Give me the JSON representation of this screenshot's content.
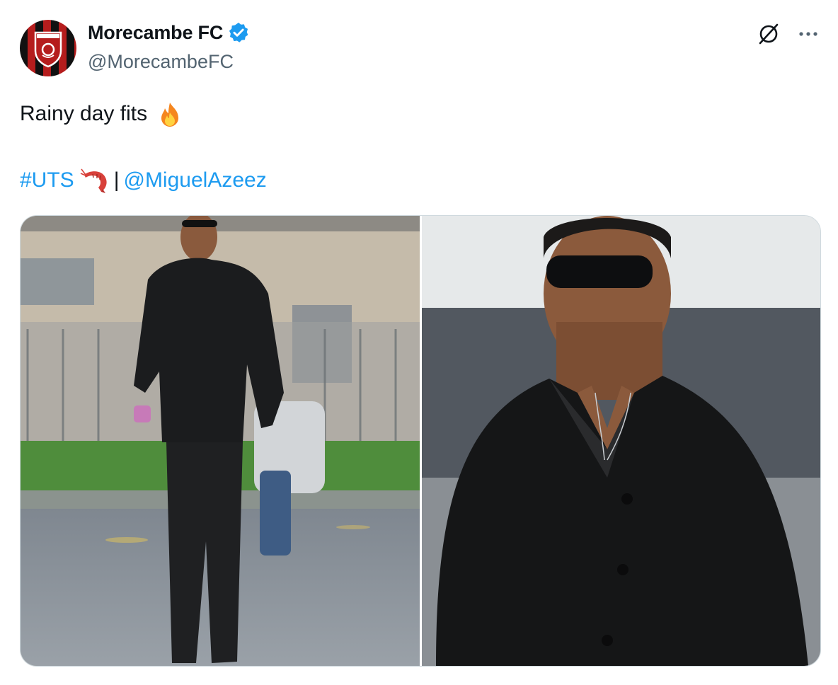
{
  "account": {
    "display_name": "Morecambe FC",
    "handle": "@MorecambeFC",
    "verified": true,
    "avatar": "morecambe-fc-crest"
  },
  "header_icons": {
    "grok": "grok-icon",
    "more": "more-options-icon"
  },
  "tweet": {
    "text": "Rainy day fits",
    "text_emoji": "fire-emoji",
    "hashtag": "#UTS",
    "hashtag_emoji": "shrimp-emoji",
    "separator": "|",
    "mention": "@MiguelAzeez"
  },
  "media": {
    "count": 2,
    "photos": [
      "photo-player-walking",
      "photo-player-closeup"
    ]
  },
  "colors": {
    "link": "#1d9bf0",
    "verified": "#1d9bf0",
    "secondary_text": "#536471",
    "border": "#cfd9de"
  }
}
